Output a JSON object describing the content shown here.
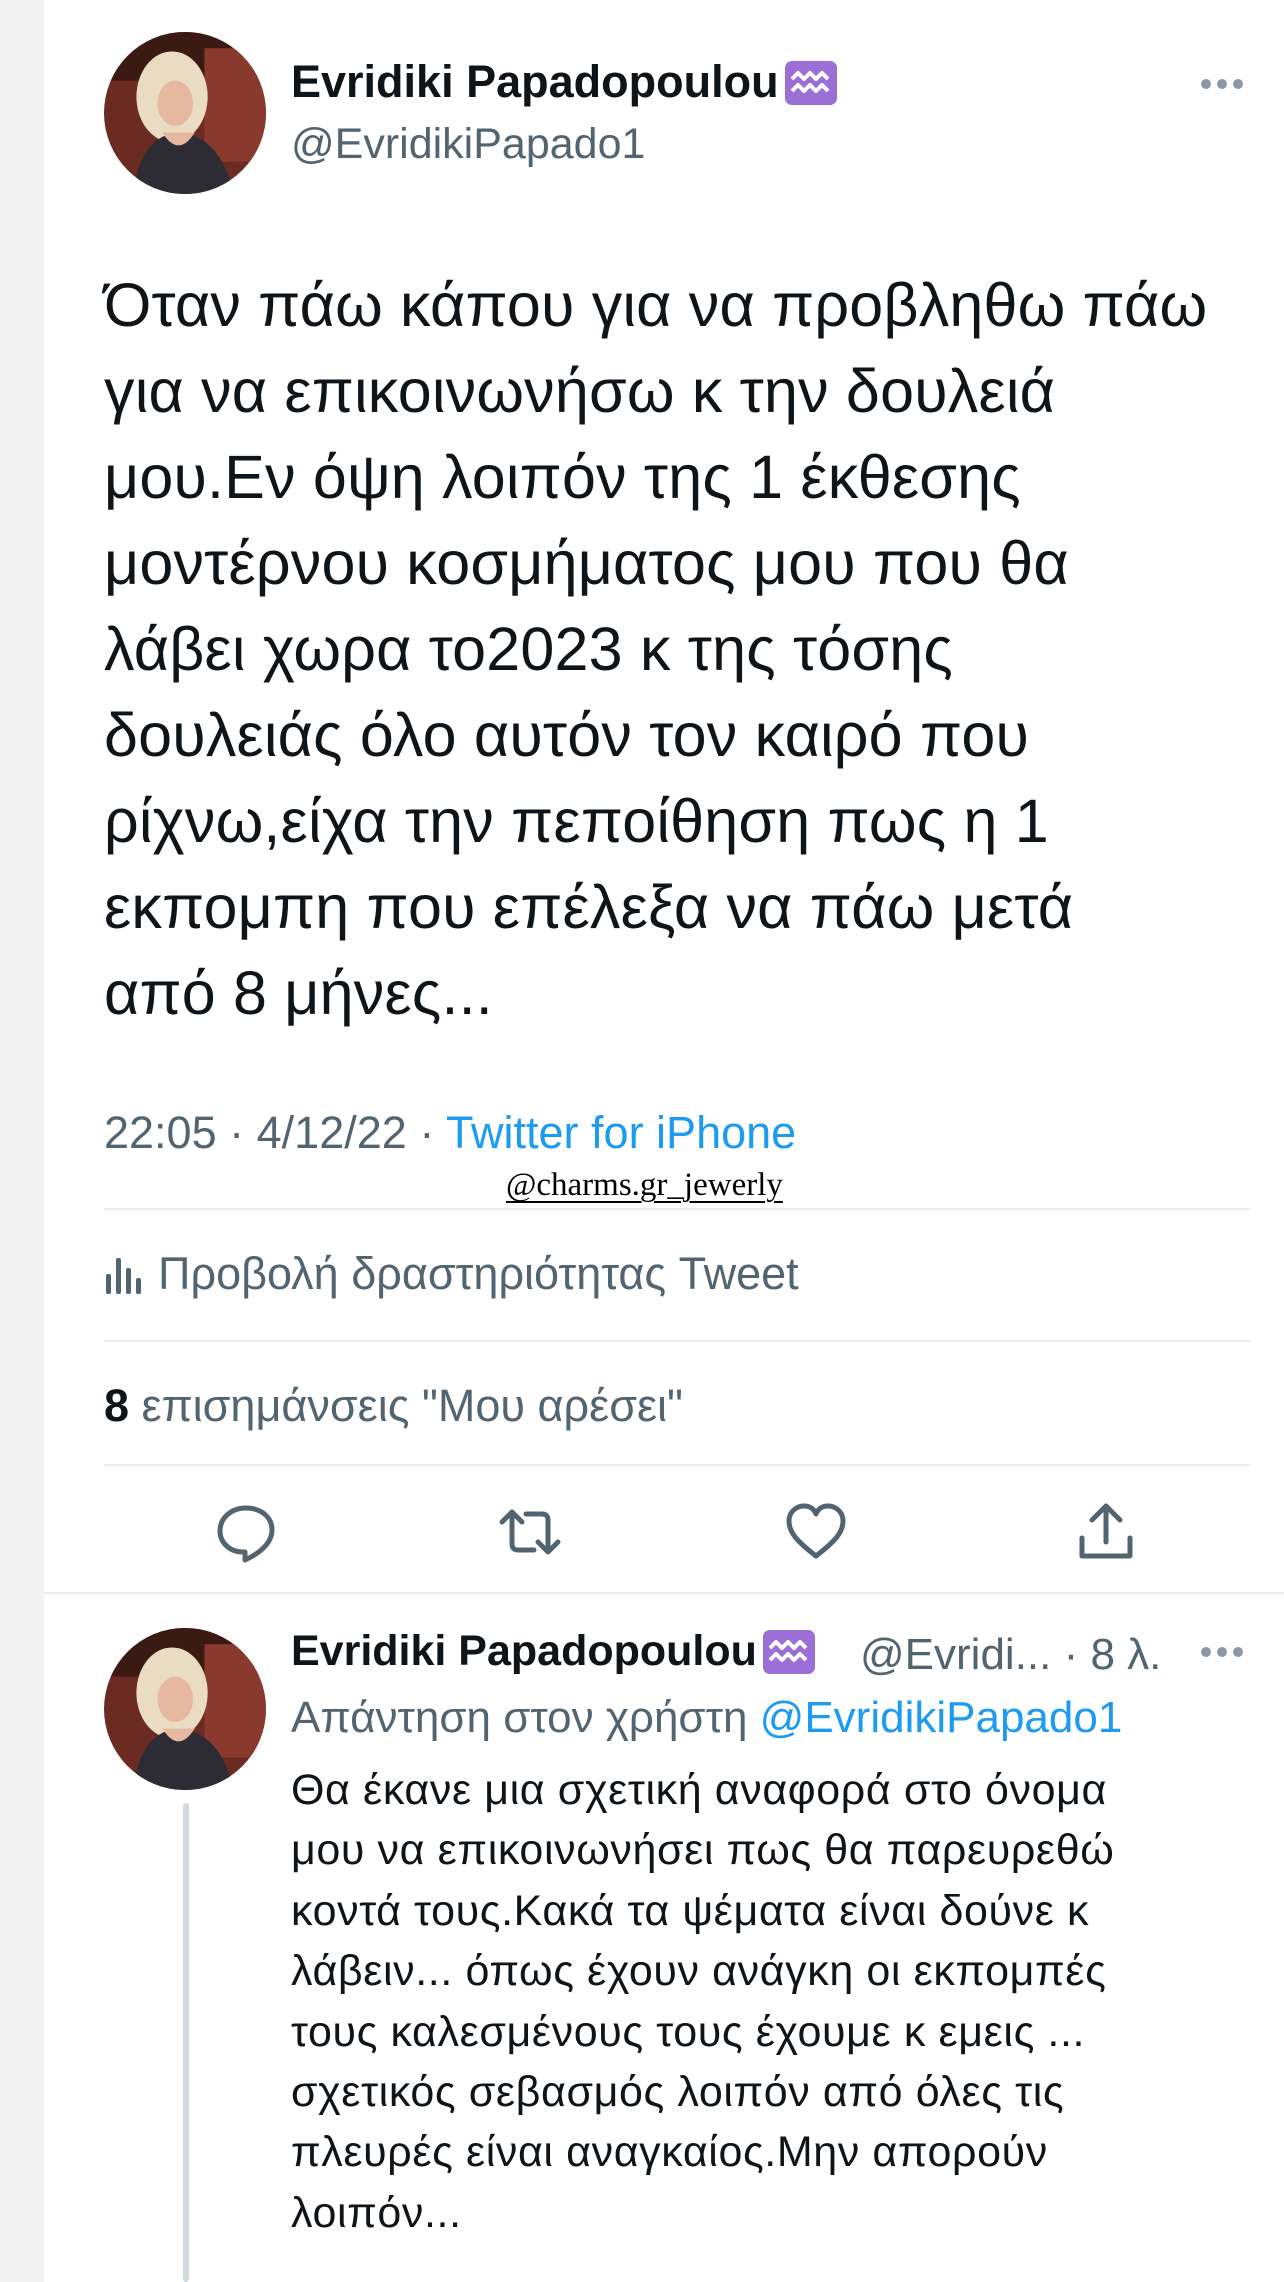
{
  "colors": {
    "text": "#0f1419",
    "secondary": "#536471",
    "link": "#1d9bf0",
    "zodiac_badge": "#9b6fd6",
    "divider": "#e8ecef"
  },
  "main_tweet": {
    "author_name": "Evridiki Papadopoulou",
    "author_badge_icon": "aquarius-icon",
    "author_handle": "@EvridikiPapado1",
    "text_lines": [
      "Όταν πάω κάπου για να προβληθω πάω",
      "για να επικοινωνήσω κ την δουλειά",
      "μου.Εν όψη λοιπόν της 1 έκθεσης",
      "μοντέρνου κοσμήματος μου που θα",
      "λάβει χωρα το2023 κ της τόσης",
      "δουλειάς όλο αυτόν τον καιρό που",
      "ρίχνω,είχα την πεποίθηση πως η 1",
      "εκπομπη  που επέλεξα να πάω μετά",
      "από 8 μήνες..."
    ],
    "time": "22:05",
    "date": "4/12/22",
    "separator": "·",
    "client": "Twitter for iPhone",
    "activity_label": "Προβολή δραστηριότητας Tweet",
    "likes_count": "8",
    "likes_label": "επισημάνσεις \"Μου αρέσει\""
  },
  "overlay_sticker": "@charms.gr_jewerly",
  "reply_tweet": {
    "author_name": "Evridiki Papadopoulou",
    "author_handle_short": "@Evridi...",
    "time_ago": "· 8 λ.",
    "reply_prefix": "Απάντηση στον χρήστη",
    "reply_mention": "@EvridikiPapado1",
    "text_lines": [
      "Θα έκανε μια σχετική αναφορά στο όνομα",
      "μου να επικοινωνήσει πως θα παρευρεθώ",
      "κοντά τους.Κακά τα ψέματα είναι δούνε κ",
      "λάβειν... όπως έχουν ανάγκη οι εκπομπές",
      "τους καλεσμένους τους έχουμε κ εμεις ...",
      "σχετικός σεβασμός λοιπόν από όλες τις",
      "πλευρές είναι αναγκαίος.Μην απορούν",
      "λοιπόν..."
    ]
  }
}
